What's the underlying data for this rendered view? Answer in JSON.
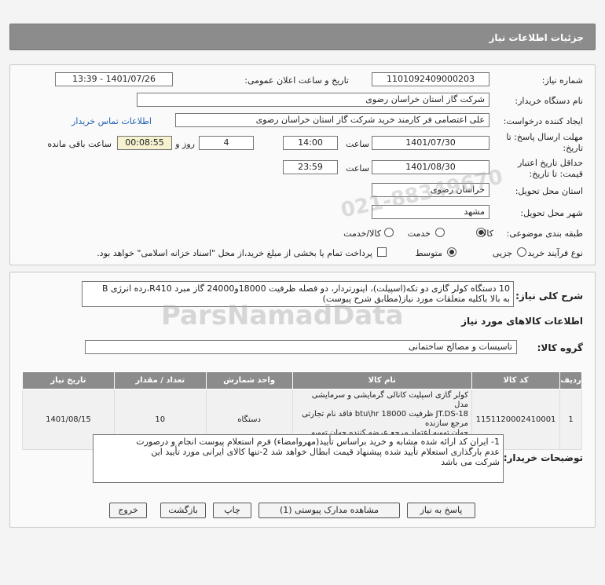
{
  "header": {
    "title": "جزئیات اطلاعات نیاز"
  },
  "form": {
    "need_number_label": "شماره نیاز:",
    "need_number": "1101092409000203",
    "announce_label": "تاریخ و ساعت اعلان عمومی:",
    "announce_value": "1401/07/26 - 13:39",
    "buyer_org_label": "نام دستگاه خریدار:",
    "buyer_org": "شرکت گاز استان خراسان رضوی",
    "creator_label": "ایجاد کننده درخواست:",
    "creator": "علی اعتصامی فر کارمند خرید شرکت گاز استان خراسان رضوی",
    "contact_link": "اطلاعات تماس خریدار",
    "deadline_label_1": "مهلت ارسال پاسخ: تا",
    "deadline_label_2": "تاریخ:",
    "deadline_date": "1401/07/30",
    "time_label": "ساعت",
    "deadline_time": "14:00",
    "days_value": "4",
    "days_label": "روز و",
    "remaining_value": "00:08:55",
    "remaining_label": "ساعت باقی مانده",
    "validity_label_1": "حداقل تاریخ اعتبار",
    "validity_label_2": "قیمت: تا تاریخ:",
    "validity_date": "1401/08/30",
    "validity_time": "23:59",
    "province_label": "استان محل تحویل:",
    "province": "خراسان رضوی",
    "city_label": "شهر محل تحویل:",
    "city": "مشهد",
    "category_label": "طبقه بندی موضوعی:",
    "category_options": [
      "کالا",
      "خدمت",
      "کالا/خدمت"
    ],
    "process_label": "نوع فرآیند خرید :",
    "process_options": [
      "جزیی",
      "متوسط"
    ],
    "payment_note": "پرداخت تمام یا بخشی از مبلغ خرید،از محل \"اسناد خزانه اسلامی\" خواهد بود."
  },
  "summary": {
    "label": "شرح کلی نیاز:",
    "text_line1": "10 دستگاه کولر گازی دو تکه(اسپیلت)، اینورتردار، دو فصله ظرفیت 18000و24000 گاز مبرد R410،رده انرژی B",
    "text_line2": "به بالا باکلیه متعلقات مورد نیاز(مطابق شرح پیوست)"
  },
  "goods": {
    "section_title": "اطلاعات کالاهای مورد نیاز",
    "group_label": "گروه کالا:",
    "group_value": "تاسیسات و مصالح ساختمانی",
    "columns": [
      "ردیف",
      "کد کالا",
      "نام کالا",
      "واحد شمارش",
      "تعداد / مقدار",
      "تاریخ نیاز"
    ],
    "rows": [
      {
        "row": "1",
        "code": "1151120002410001",
        "name_line1": "کولر گازی اسپلیت کانالی گرمایشی و سرمایشی مدل",
        "name_line2": "JT.DS-18 ظرفیت btu\\hr 18000 فاقد نام تجارتی مرجع سازنده",
        "name_line3": "جهان تهویه اعتماد مرجع عرضه کننده جهان تهویه اعتماد",
        "unit": "دستگاه",
        "qty": "10",
        "date": "1401/08/15"
      }
    ]
  },
  "buyer_notes": {
    "label": "توضیحات خریدار:",
    "line1": "1- ایران کد ارائه شده مشابه و خرید براساس تأیید(مهروامضاء) فرم استعلام پیوست انجام و درصورت",
    "line2": "عدم بارگذاری استعلام تأیید شده پیشنهاد قیمت ابطال خواهد شد 2-تنها کالای ایرانی مورد تأیید این",
    "line3": "شرکت می باشد"
  },
  "buttons": {
    "reply": "پاسخ به نیاز",
    "attachments": "مشاهده مدارک پیوستی (1)",
    "print": "چاپ",
    "back": "بازگشت",
    "exit": "خروج"
  },
  "watermark": {
    "brand": "ParsNamadData",
    "number": "021-88349670"
  }
}
